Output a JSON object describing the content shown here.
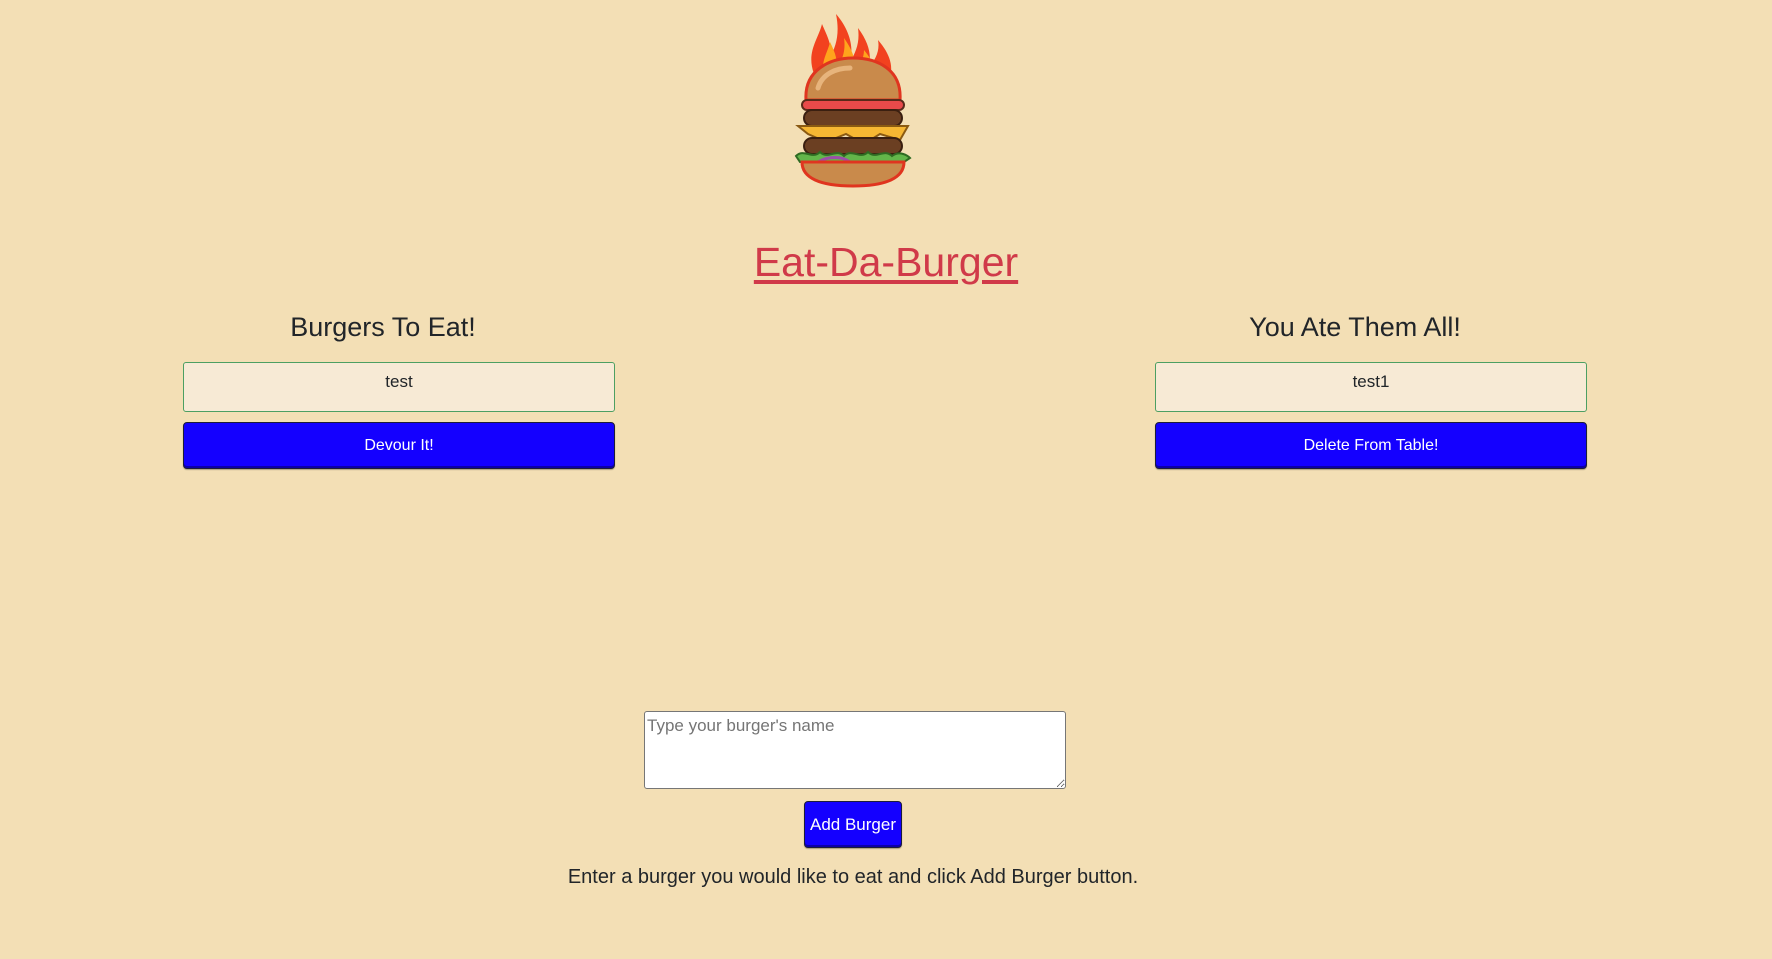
{
  "header": {
    "logo_icon": "flaming-burger-icon",
    "title": "Eat-Da-Burger"
  },
  "to_eat": {
    "heading": "Burgers To Eat!",
    "items": [
      {
        "name": "test",
        "button_label": "Devour It!"
      }
    ]
  },
  "eaten": {
    "heading": "You Ate Them All!",
    "items": [
      {
        "name": "test1",
        "button_label": "Delete From Table!"
      }
    ]
  },
  "form": {
    "placeholder": "Type your burger's name",
    "value": "",
    "submit_label": "Add Burger",
    "instructions": "Enter a burger you would like to eat and click Add Burger button."
  },
  "colors": {
    "background": "#f3dfb5",
    "title": "#d03a49",
    "button": "#1400ff",
    "item_background": "#f7ead5",
    "item_border": "#4c9f62"
  }
}
